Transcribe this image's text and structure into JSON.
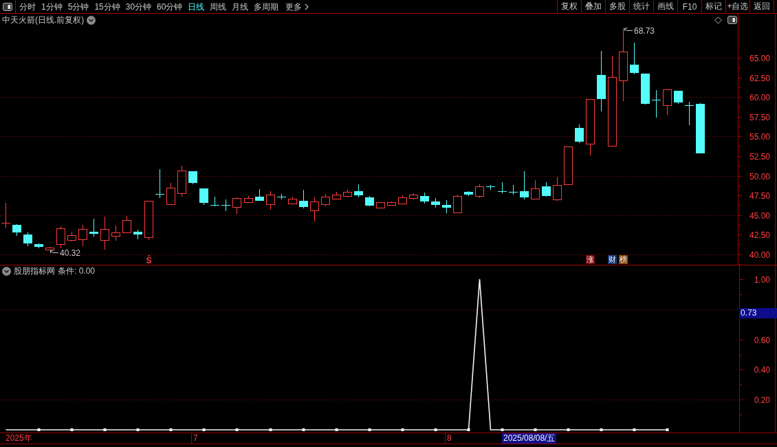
{
  "toolbar": {
    "tabs": [
      {
        "label": "分时",
        "selected": false
      },
      {
        "label": "1分钟",
        "selected": false
      },
      {
        "label": "5分钟",
        "selected": false
      },
      {
        "label": "15分钟",
        "selected": false
      },
      {
        "label": "30分钟",
        "selected": false
      },
      {
        "label": "60分钟",
        "selected": false
      },
      {
        "label": "日线",
        "selected": true
      },
      {
        "label": "周线",
        "selected": false
      },
      {
        "label": "月线",
        "selected": false
      },
      {
        "label": "多周期",
        "selected": false
      }
    ],
    "more": "更多",
    "buttons": [
      "复权",
      "叠加",
      "多股",
      "统计",
      "画线",
      "F10",
      "标记",
      "+自选",
      "返回"
    ]
  },
  "price_panel": {
    "title": "中天火箭(日线.前复权)",
    "axis_labels": [
      "65.00",
      "62.50",
      "60.00",
      "57.50",
      "55.00",
      "52.50",
      "50.00",
      "47.50",
      "45.00",
      "42.50",
      "40.00"
    ],
    "high_label": "68.73",
    "low_label": "40.32",
    "signal": "Ŝ",
    "badges": [
      {
        "label": "涨",
        "color": "#7a0c0c"
      },
      {
        "label": "财",
        "color": "#173a7a"
      },
      {
        "label": "榜",
        "color": "#8a4a12"
      }
    ]
  },
  "indicator_panel": {
    "name": "股朋指标网",
    "readout": "条件: 0.00",
    "cursor_value": "0.73",
    "chart_data": {
      "type": "line",
      "categories": [
        null,
        null,
        null,
        null,
        null,
        null,
        null,
        null,
        null,
        null,
        null,
        null,
        null,
        null,
        null,
        null,
        null,
        null,
        null,
        null,
        null,
        null,
        null,
        null,
        null,
        null,
        null,
        null,
        null,
        null,
        null,
        null,
        null,
        null,
        null,
        null,
        null,
        null,
        null,
        null,
        null,
        null,
        null,
        null,
        null,
        null,
        null,
        null,
        null,
        null,
        null,
        null,
        null,
        null,
        null,
        null,
        null,
        null,
        null,
        null,
        null,
        null,
        null,
        null,
        null,
        null,
        null
      ],
      "values": [
        0,
        0,
        0,
        0,
        0,
        0,
        0,
        0,
        0,
        0,
        0,
        0,
        0,
        0,
        0,
        0,
        0,
        0,
        0,
        0,
        0,
        0,
        0,
        0,
        0,
        0,
        0,
        0,
        0,
        0,
        0,
        0,
        0,
        0,
        0,
        0,
        0,
        0,
        0,
        0,
        0,
        0,
        0,
        1,
        0,
        0,
        0,
        0,
        0,
        0,
        0,
        0,
        0,
        0,
        0,
        0,
        0,
        0,
        0,
        0,
        0,
        null,
        null,
        null,
        null,
        null,
        null
      ],
      "ylim": [
        -0.014,
        1.091
      ],
      "yticks": [
        {
          "value": 1,
          "label": "1.00"
        },
        {
          "value": 0.6,
          "label": "0.60"
        },
        {
          "value": 0.4,
          "label": "0.40"
        },
        {
          "value": 0.2,
          "label": "0.20"
        }
      ],
      "ref_lines": [
        {
          "axis": "y",
          "value": 0.8
        },
        {
          "axis": "y",
          "value": 0.2
        }
      ]
    }
  },
  "date_axis": {
    "labels": [
      "2025年",
      "7",
      "8"
    ],
    "cursor_date": "2025/08/08/五"
  }
}
